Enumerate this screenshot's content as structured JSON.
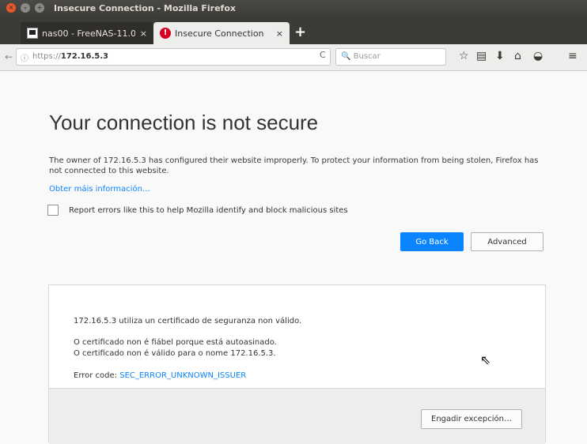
{
  "window": {
    "title": "Insecure Connection - Mozilla Firefox",
    "controls": {
      "close": "×",
      "minimize": "–",
      "maximize": "+"
    }
  },
  "tabs": [
    {
      "label": "nas00 - FreeNAS-11.0 - ",
      "close": "×",
      "icon": "freenas-favicon"
    },
    {
      "label": "Insecure Connection",
      "close": "×",
      "icon": "warning-favicon"
    }
  ],
  "new_tab_label": "+",
  "navbar": {
    "back_icon": "←",
    "info_icon": "ⓘ",
    "url_scheme": "https://",
    "url_host": "172.16.5.3",
    "reload_icon": "C",
    "search_placeholder": "🔍 Buscar",
    "toolbar_icons": {
      "bookmark": "☆",
      "library": "▤",
      "download": "⬇",
      "home": "⌂",
      "pocket": "◒",
      "menu": "≡"
    }
  },
  "error_page": {
    "title": "Your connection is not secure",
    "description": "The owner of 172.16.5.3 has configured their website improperly. To protect your information from being stolen, Firefox has not connected to this website.",
    "learn_more": "Obter máis información…",
    "report_checkbox_label": "Report errors like this to help Mozilla identify and block malicious sites",
    "go_back_label": "Go Back",
    "advanced_label": "Advanced"
  },
  "advanced_panel": {
    "line1": "172.16.5.3 utiliza un certificado de seguranza non válido.",
    "line2": "O certificado non é fiábel porque está autoasinado.",
    "line3": "O certificado non é válido para o nome 172.16.5.3.",
    "error_code_prefix": "Error code: ",
    "error_code": "SEC_ERROR_UNKNOWN_ISSUER",
    "add_exception_label": "Engadir excepción…"
  },
  "colors": {
    "primary_button": "#0a84ff",
    "link": "#0a84ff",
    "title_bar": "#3c3b37",
    "close_button": "#e9572c"
  }
}
